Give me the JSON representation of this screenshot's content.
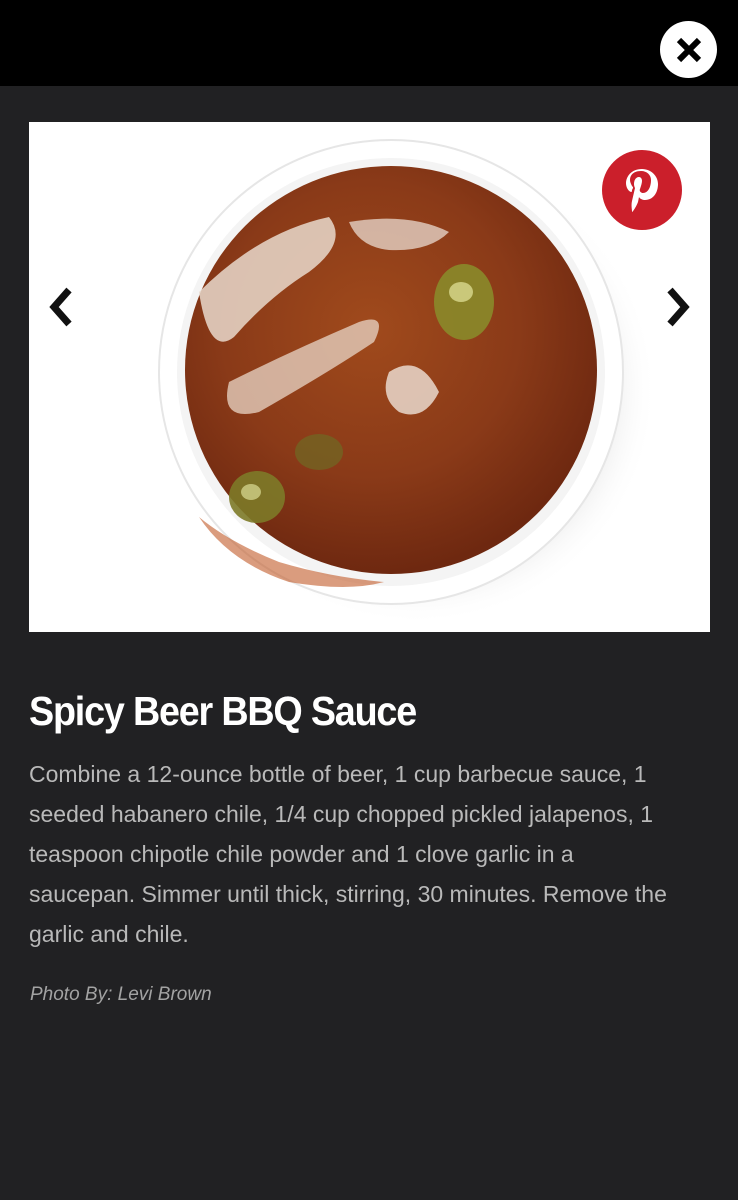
{
  "slide": {
    "title": "Spicy Beer BBQ Sauce",
    "description": "Combine a 12-ounce bottle of beer, 1 cup barbecue sauce, 1 seeded habanero chile, 1/4 cup chopped pickled jalapenos, 1 teaspoon chipotle chile powder and 1 clove garlic in a saucepan. Simmer until thick, stirring, 30 minutes. Remove the garlic and chile.",
    "photo_credit": "Photo By: Levi Brown"
  },
  "icons": {
    "close": "close-icon",
    "pinterest": "pinterest-icon",
    "previous": "chevron-left-icon",
    "next": "chevron-right-icon"
  },
  "colors": {
    "background": "#212123",
    "top_bar": "#000000",
    "pinterest_red": "#cb1f2b",
    "sauce": "#8a3a18"
  }
}
